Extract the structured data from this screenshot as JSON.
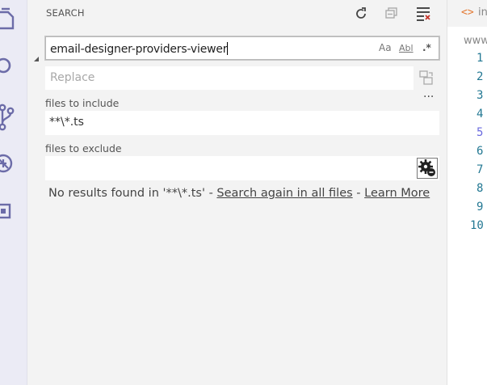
{
  "sidebar": {
    "title": "SEARCH",
    "actions": [
      {
        "icon": "refresh-icon"
      },
      {
        "icon": "collapse-all-icon"
      },
      {
        "icon": "clear-results-icon"
      }
    ],
    "search_value": "email-designer-providers-viewer",
    "options": {
      "match_case": "Aa",
      "whole_word": "Abl",
      "regex": ".*"
    },
    "replace_placeholder": "Replace",
    "more_label": "...",
    "include_label": "files to include",
    "include_value": "**\\*.ts",
    "exclude_label": "files to exclude",
    "exclude_value": "",
    "message": {
      "prefix": "No results found in '**\\*.ts' - ",
      "search_again": "Search again in all files",
      "sep": " - ",
      "learn_more": "Learn More"
    }
  },
  "editor": {
    "tab_icon": "<>",
    "tab_label": "in",
    "breadcrumb": "www",
    "line_numbers": [
      "1",
      "2",
      "3",
      "4",
      "5",
      "6",
      "7",
      "8",
      "9",
      "10"
    ],
    "active_line": "5"
  },
  "colors": {
    "accent": "#6a6adf",
    "line_number": "#237893",
    "tab_icon": "#e37933"
  }
}
